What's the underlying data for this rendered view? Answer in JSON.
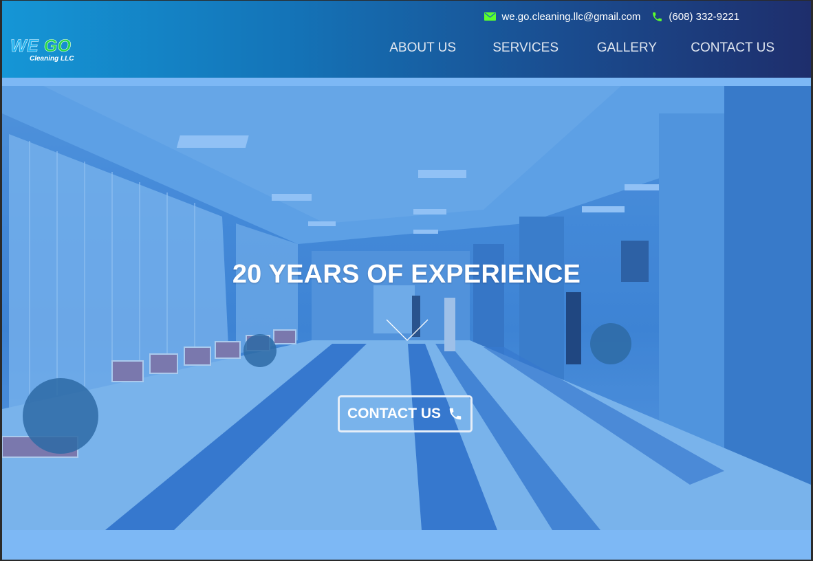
{
  "header": {
    "email": "we.go.cleaning.llc@gmail.com",
    "phone": "(608) 332-9221",
    "icons": {
      "email": "envelope-icon",
      "phone": "phone-icon"
    },
    "icon_color": "#5cff2d"
  },
  "logo": {
    "word1": "WE",
    "word2": "GO",
    "subtitle": "Cleaning LLC",
    "colors": {
      "we": "#1fb4f0",
      "go": "#27d84a"
    }
  },
  "nav": {
    "items": [
      {
        "label": "ABOUT US"
      },
      {
        "label": "SERVICES"
      },
      {
        "label": "GALLERY"
      },
      {
        "label": "CONTACT US"
      }
    ]
  },
  "hero": {
    "title": "20 YEARS OF EXPERIENCE",
    "cta_label": "CONTACT US",
    "cta_icon": "phone-icon",
    "scroll_icon": "chevron-down-icon"
  },
  "colors": {
    "header_gradient_start": "#1596d6",
    "header_gradient_end": "#1e2e6c",
    "page_background": "#7db8f5"
  }
}
